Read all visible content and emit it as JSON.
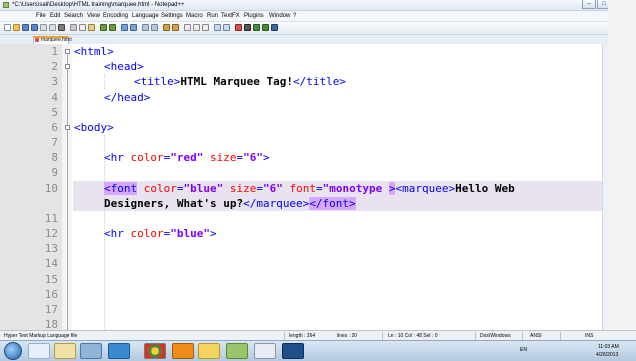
{
  "window": {
    "title": "*C:\\Users\\sali\\Desktop\\HTML training\\marquee.html - Notepad++",
    "buttons": {
      "minimize": "–",
      "maximize": "□",
      "close": "✕"
    }
  },
  "menu": [
    "File",
    "Edit",
    "Search",
    "View",
    "Encoding",
    "Language",
    "Settings",
    "Macro",
    "Run",
    "TextFX",
    "Plugins",
    "Window",
    "?"
  ],
  "menu_close": "X",
  "tab": {
    "label": "marquee.html"
  },
  "editor": {
    "line_numbers": [
      "1",
      "2",
      "3",
      "4",
      "5",
      "6",
      "7",
      "8",
      "9",
      "10",
      "",
      "11",
      "12",
      "13",
      "14",
      "15",
      "16",
      "17",
      "18"
    ],
    "lines": {
      "l1": {
        "t1": "<html>"
      },
      "l2": {
        "t1": "<head>"
      },
      "l3": {
        "t1": "<title>",
        "x1": "HTML Marquee Tag!",
        "t2": "</title>"
      },
      "l4": {
        "t1": "</head>"
      },
      "l6": {
        "t1": "<body>"
      },
      "l8": {
        "t1": "<hr ",
        "a1": "color",
        "t2": "=",
        "v1": "\"red\"",
        "a2": " size",
        "t3": "=",
        "v2": "\"6\"",
        "t4": ">"
      },
      "l10a": {
        "t1": "<font",
        "a1": " color",
        "t2": "=",
        "v1": "\"blue\"",
        "a2": " size",
        "t3": "=",
        "v2": "\"6\"",
        "a3": " font",
        "t4": "=",
        "v3": "\"monotype ",
        "t5": ">",
        "t6": "<marquee>",
        "x1": "Hello Web"
      },
      "l10b": {
        "x1": "Designers, What's up?",
        "t1": "</marquee>",
        "t2": "</font>"
      },
      "l12": {
        "t1": "<hr ",
        "a1": "color",
        "t2": "=",
        "v1": "\"blue\"",
        "t3": ">"
      }
    }
  },
  "status": {
    "filetype": "Hyper Text Markup Language file",
    "length": "length : 264",
    "lines": "lines : 20",
    "position": "Ln : 10    Col : 48    Sel : 0",
    "eol": "Dos\\Windows",
    "encoding": "ANSI",
    "mode": "INS"
  },
  "tray": {
    "lang": "EN",
    "time": "11:03 AM",
    "date": "4/26/2013"
  },
  "colors": {
    "tag": "#0000ff",
    "attr": "#ff0000",
    "value": "#8000ff",
    "selection": "#d7a6ff",
    "current_line": "#e8e3ef"
  }
}
